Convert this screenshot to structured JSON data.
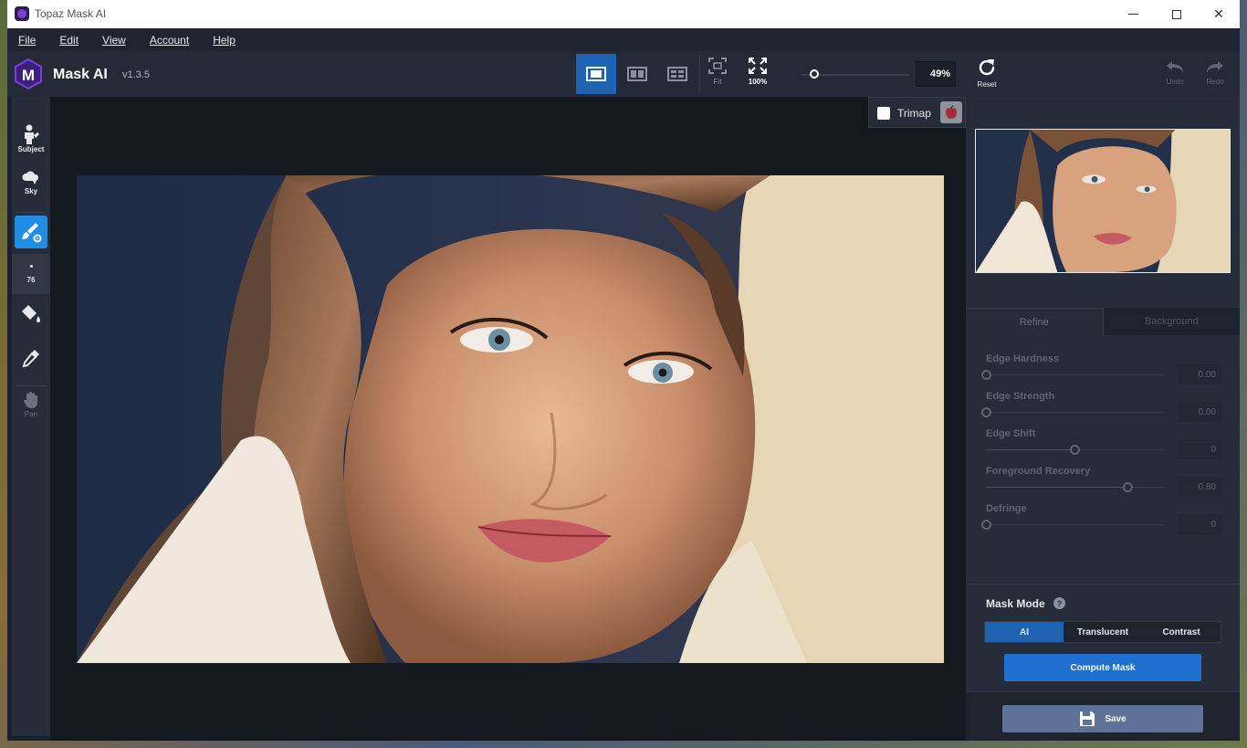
{
  "window": {
    "title": "Topaz Mask AI"
  },
  "menu": {
    "items": [
      "File",
      "Edit",
      "View",
      "Account",
      "Help"
    ]
  },
  "toolbar": {
    "brand": "Mask AI",
    "version": "v1.3.5",
    "fit_label": "Fit",
    "zoom100_label": "100%",
    "zoom_value": "49%",
    "zoom_level": 0.12,
    "reset_label": "Reset",
    "undo_label": "Undo",
    "redo_label": "Redo"
  },
  "left_tools": {
    "subject_label": "Subject",
    "sky_label": "Sky",
    "brush_size": "76",
    "pan_label": "Pan"
  },
  "canvas": {
    "trimap_label": "Trimap"
  },
  "panel": {
    "tabs": [
      "Refine",
      "Background"
    ],
    "params": [
      {
        "label": "Edge Hardness",
        "value": "0.00",
        "level": 0.0
      },
      {
        "label": "Edge Strength",
        "value": "0.00",
        "level": 0.0
      },
      {
        "label": "Edge Shift",
        "value": "0",
        "level": 0.5
      },
      {
        "label": "Foreground Recovery",
        "value": "0.80",
        "level": 0.8
      },
      {
        "label": "Defringe",
        "value": "0",
        "level": 0.0
      }
    ],
    "mask_mode_title": "Mask Mode",
    "mask_modes": [
      "AI",
      "Translucent",
      "Contrast"
    ],
    "compute_label": "Compute Mask",
    "save_label": "Save"
  },
  "colors": {
    "accent": "#1f63b5",
    "compute": "#1f6ed0",
    "active_tool": "#1f8de4"
  }
}
